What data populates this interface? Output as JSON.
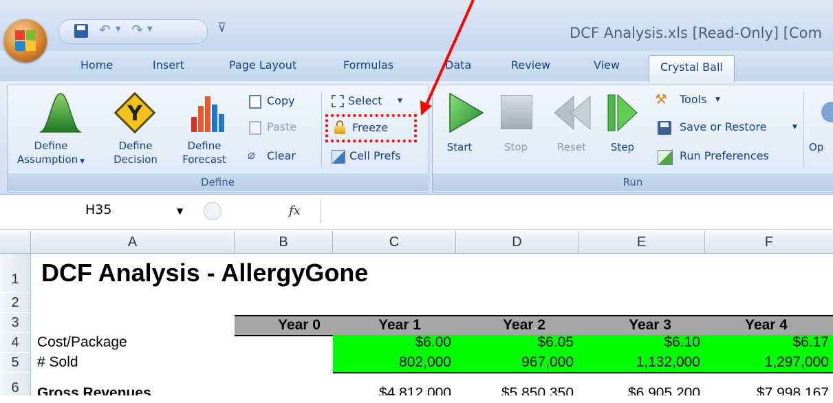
{
  "window": {
    "title": "DCF Analysis.xls  [Read-Only]  [Com"
  },
  "tabs": [
    "Home",
    "Insert",
    "Page Layout",
    "Formulas",
    "Data",
    "Review",
    "View",
    "Crystal Ball"
  ],
  "define_group": {
    "label": "Define",
    "define_assumption": [
      "Define",
      "Assumption"
    ],
    "define_decision": [
      "Define",
      "Decision"
    ],
    "define_forecast": [
      "Define",
      "Forecast"
    ],
    "copy": "Copy",
    "paste": "Paste",
    "clear": "Clear",
    "select": "Select",
    "freeze": "Freeze",
    "cell_prefs": "Cell Prefs"
  },
  "run_group": {
    "label": "Run",
    "start": "Start",
    "stop": "Stop",
    "reset": "Reset",
    "step": "Step",
    "tools": "Tools",
    "save_or_restore": "Save or Restore",
    "run_preferences": "Run Preferences",
    "op": "Op"
  },
  "formula_bar": {
    "name_box": "H35",
    "fx": "fx",
    "formula": ""
  },
  "sheet": {
    "columns": [
      "A",
      "B",
      "C",
      "D",
      "E",
      "F"
    ],
    "rows": [
      "1",
      "2",
      "3",
      "4",
      "5",
      "6"
    ],
    "title": "DCF Analysis - AllergyGone",
    "year_headers": [
      "Year 0",
      "Year 1",
      "Year 2",
      "Year 3",
      "Year 4"
    ],
    "row4_label": "Cost/Package",
    "row4_values": [
      "$6.00",
      "$6.05",
      "$6.10",
      "$6.17"
    ],
    "row5_label": "# Sold",
    "row5_values": [
      "802,000",
      "967,000",
      "1,132,000",
      "1,297,000"
    ],
    "row6_label": "Gross Revenues",
    "row6_values": [
      "$4,812,000",
      "$5,850,350",
      "$6,905,200",
      "$7,998,167"
    ]
  },
  "colors": {
    "input_green": "#00ff00",
    "header_grey": "#a6a6a6",
    "annotation_red": "#ff0000"
  }
}
